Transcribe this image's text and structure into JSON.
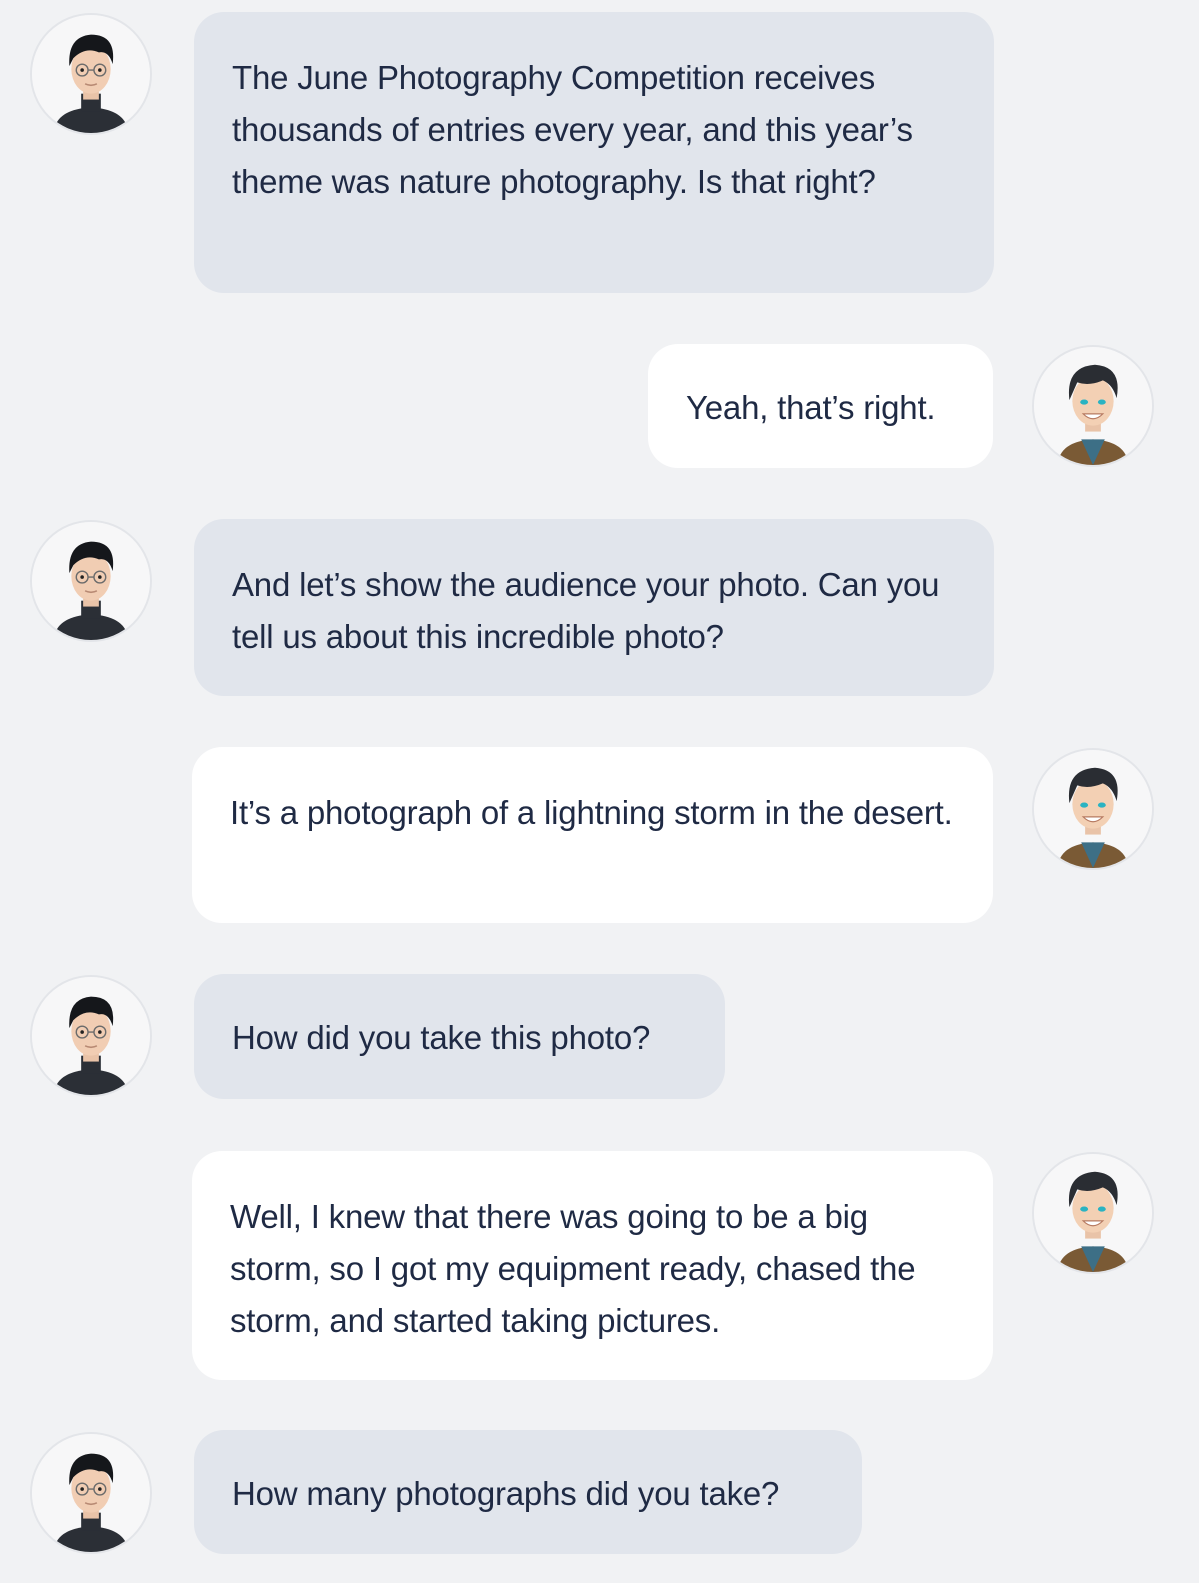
{
  "conversation": {
    "messages": [
      {
        "speaker": "host",
        "avatar_icon": "host-avatar-icon",
        "text": "The June Photography Competition receives thousands of entries every year, and this year’s theme was nature photography. Is that right?"
      },
      {
        "speaker": "guest",
        "avatar_icon": "guest-avatar-icon",
        "text": "Yeah, that’s right."
      },
      {
        "speaker": "host",
        "avatar_icon": "host-avatar-icon",
        "text": "And let’s show the audience your photo. Can you tell us about this incredible photo?"
      },
      {
        "speaker": "guest",
        "avatar_icon": "guest-avatar-icon",
        "text": "It’s a photograph of a lightning storm in the desert."
      },
      {
        "speaker": "host",
        "avatar_icon": "host-avatar-icon",
        "text": "How did you take this photo?"
      },
      {
        "speaker": "guest",
        "avatar_icon": "guest-avatar-icon",
        "text": "Well, I knew that there was going to be a big storm, so I got my equipment ready, chased the storm, and started taking pictures."
      },
      {
        "speaker": "host",
        "avatar_icon": "host-avatar-icon",
        "text": "How many photographs did you take?"
      }
    ]
  },
  "colors": {
    "background": "#f1f2f4",
    "host_bubble": "#e1e5ec",
    "guest_bubble": "#ffffff",
    "text": "#1f2a44"
  }
}
